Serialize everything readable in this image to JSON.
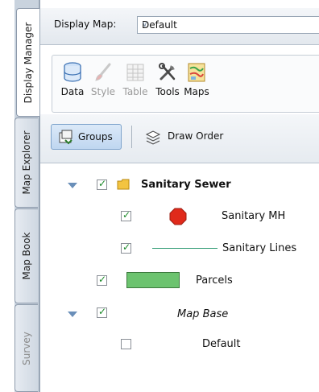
{
  "tabs": [
    {
      "label": "Display Manager",
      "active": true
    },
    {
      "label": "Map Explorer",
      "active": false
    },
    {
      "label": "Map Book",
      "active": false
    },
    {
      "label": "Survey",
      "active": false
    }
  ],
  "display_map": {
    "label": "Display Map:",
    "value": "Default"
  },
  "ribbon": [
    {
      "label": "Data",
      "icon": "database-icon",
      "enabled": true
    },
    {
      "label": "Style",
      "icon": "brush-icon",
      "enabled": false
    },
    {
      "label": "Table",
      "icon": "table-icon",
      "enabled": false
    },
    {
      "label": "Tools",
      "icon": "tools-icon",
      "enabled": true
    },
    {
      "label": "Maps",
      "icon": "maps-icon",
      "enabled": true
    }
  ],
  "toolbar": {
    "groups_label": "Groups",
    "draw_order_label": "Draw Order"
  },
  "tree": {
    "sanitary_sewer": "Sanitary Sewer",
    "sanitary_mh": "Sanitary MH",
    "sanitary_lines": "Sanitary Lines",
    "parcels": "Parcels",
    "map_base": "Map Base",
    "default": "Default"
  },
  "colors": {
    "manhole": "#e02a1b",
    "line": "#2e9a73",
    "parcel": "#6cc36f",
    "folder": "#e8b230",
    "accent": "#6a8fb9"
  }
}
